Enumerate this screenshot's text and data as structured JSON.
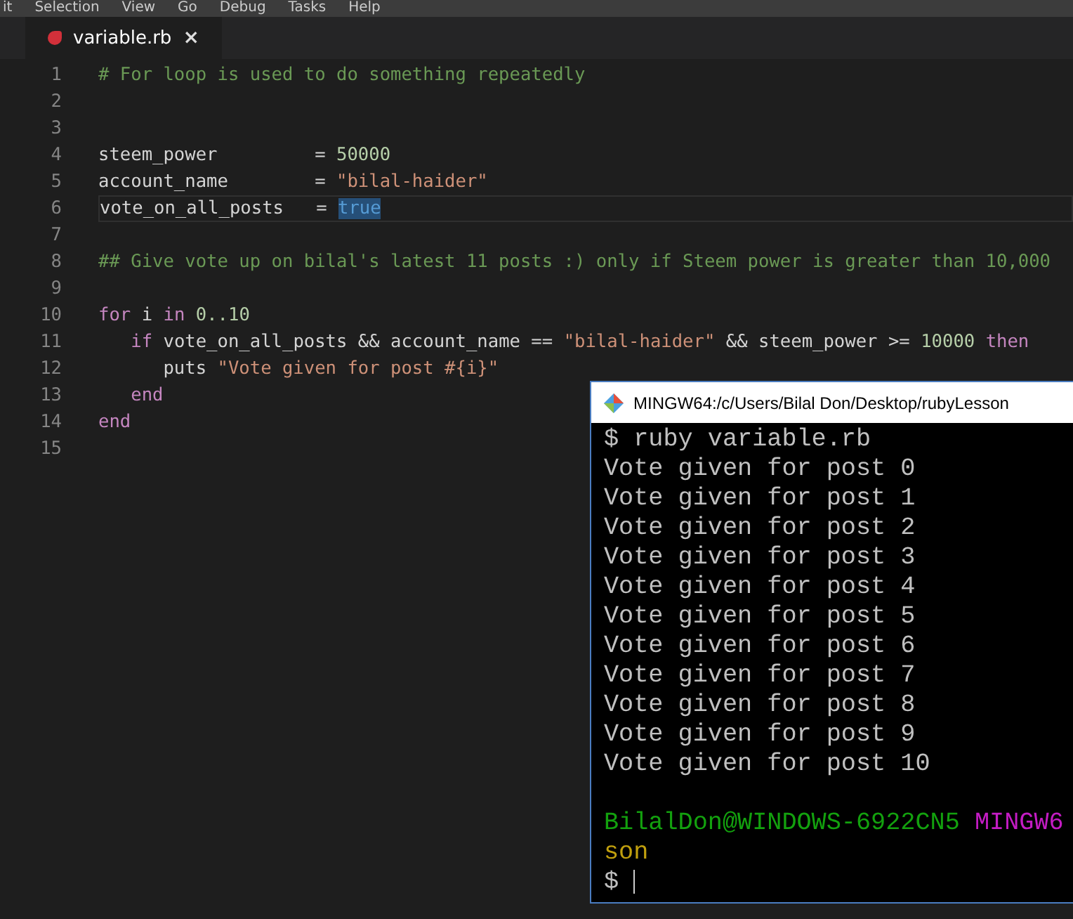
{
  "menu_bar": [
    "it",
    "Selection",
    "View",
    "Go",
    "Debug",
    "Tasks",
    "Help"
  ],
  "tabs": [
    {
      "label": "variable.rb",
      "selected": true,
      "close": "×"
    }
  ],
  "editor": {
    "lines": [
      {
        "number": "1",
        "current": false,
        "tokens": [
          {
            "kind": "comment",
            "text": "# For loop is used to do something repeatedly"
          }
        ]
      },
      {
        "number": "2",
        "current": false
      },
      {
        "number": "3",
        "current": false
      },
      {
        "number": "4",
        "current": false,
        "tokens": [
          {
            "kind": "ident",
            "text": "steem_power         = "
          },
          {
            "kind": "number",
            "text": "50000"
          }
        ]
      },
      {
        "number": "5",
        "current": false,
        "tokens": [
          {
            "kind": "ident",
            "text": "account_name        = "
          },
          {
            "kind": "string",
            "text": "\"bilal-haider\""
          }
        ]
      },
      {
        "number": "6",
        "current": true,
        "tokens": [
          {
            "kind": "ident",
            "text": "vote_on_all_posts   = "
          },
          {
            "kind": "constant",
            "text": "true"
          }
        ]
      },
      {
        "number": "7",
        "current": false
      },
      {
        "number": "8",
        "current": false,
        "tokens": [
          {
            "kind": "comment",
            "text": "## Give vote up on bilal's latest 11 posts :) only if Steem power is greater than 10,000"
          }
        ]
      },
      {
        "number": "9",
        "current": false
      },
      {
        "number": "10",
        "current": false,
        "tokens": [
          {
            "kind": "keyword",
            "text": "for"
          },
          {
            "kind": "ident",
            "text": " i "
          },
          {
            "kind": "keyword",
            "text": "in "
          },
          {
            "kind": "number",
            "text": "0..10"
          }
        ]
      },
      {
        "number": "11",
        "current": false,
        "tokens": [
          {
            "kind": "keyword",
            "text": "   if"
          },
          {
            "kind": "ident",
            "text": " vote_on_all_posts && account_name == "
          },
          {
            "kind": "string",
            "text": "\"bilal-haider\""
          },
          {
            "kind": "ident",
            "text": " && steem_power >= "
          },
          {
            "kind": "number",
            "text": "10000 "
          },
          {
            "kind": "keyword",
            "text": "then"
          }
        ]
      },
      {
        "number": "12",
        "current": false,
        "tokens": [
          {
            "kind": "ident",
            "text": "      puts "
          },
          {
            "kind": "string",
            "text": "\"Vote given for post #{i}\""
          }
        ]
      },
      {
        "number": "13",
        "current": false,
        "tokens": [
          {
            "kind": "keyword",
            "text": "   end"
          }
        ]
      },
      {
        "number": "14",
        "current": false,
        "tokens": [
          {
            "kind": "keyword",
            "text": "end"
          }
        ]
      },
      {
        "number": "15",
        "current": false
      }
    ]
  },
  "terminal": {
    "title": "MINGW64:/c/Users/Bilal Don/Desktop/rubyLesson",
    "lines": [
      {
        "kind": "command",
        "segments": [
          {
            "kind": "plain",
            "text": "$ ruby variable.rb"
          }
        ]
      },
      {
        "kind": "output",
        "segments": [
          {
            "kind": "plain",
            "text": "Vote given for post 0"
          }
        ]
      },
      {
        "kind": "output",
        "segments": [
          {
            "kind": "plain",
            "text": "Vote given for post 1"
          }
        ]
      },
      {
        "kind": "output",
        "segments": [
          {
            "kind": "plain",
            "text": "Vote given for post 2"
          }
        ]
      },
      {
        "kind": "output",
        "segments": [
          {
            "kind": "plain",
            "text": "Vote given for post 3"
          }
        ]
      },
      {
        "kind": "output",
        "segments": [
          {
            "kind": "plain",
            "text": "Vote given for post 4"
          }
        ]
      },
      {
        "kind": "output",
        "segments": [
          {
            "kind": "plain",
            "text": "Vote given for post 5"
          }
        ]
      },
      {
        "kind": "output",
        "segments": [
          {
            "kind": "plain",
            "text": "Vote given for post 6"
          }
        ]
      },
      {
        "kind": "output",
        "segments": [
          {
            "kind": "plain",
            "text": "Vote given for post 7"
          }
        ]
      },
      {
        "kind": "output",
        "segments": [
          {
            "kind": "plain",
            "text": "Vote given for post 8"
          }
        ]
      },
      {
        "kind": "output",
        "segments": [
          {
            "kind": "plain",
            "text": "Vote given for post 9"
          }
        ]
      },
      {
        "kind": "output",
        "segments": [
          {
            "kind": "plain",
            "text": "Vote given for post 10"
          }
        ]
      },
      {
        "kind": "prompt",
        "segments": [
          {
            "kind": "user",
            "text": "BilalDon@WINDOWS-6922CN5"
          },
          {
            "kind": "system",
            "text": " MINGW6"
          }
        ]
      },
      {
        "kind": "output",
        "segments": [
          {
            "kind": "path",
            "text": "son"
          }
        ]
      },
      {
        "kind": "command",
        "segments": [
          {
            "kind": "plain",
            "text": "$"
          },
          {
            "kind": "cursor"
          }
        ]
      }
    ]
  }
}
